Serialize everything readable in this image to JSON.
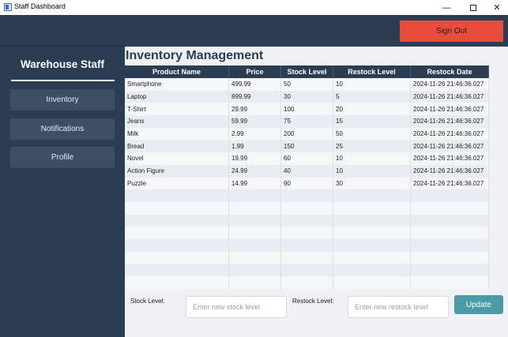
{
  "window": {
    "title": "Staff Dashboard",
    "min_glyph": "—",
    "close_glyph": "✕"
  },
  "header": {
    "signout_label": "Sign Out"
  },
  "sidebar": {
    "title": "Warehouse Staff",
    "items": [
      {
        "label": "Inventory"
      },
      {
        "label": "Notifications"
      },
      {
        "label": "Profile"
      }
    ]
  },
  "main": {
    "title": "Inventory Management"
  },
  "table": {
    "columns": [
      "Product Name",
      "Price",
      "Stock Level",
      "Restock Level",
      "Restock Date"
    ],
    "rows": [
      [
        "Smartphone",
        "499.99",
        "50",
        "10",
        "2024-11-26 21:46:36.027"
      ],
      [
        "Laptop",
        "899.99",
        "30",
        "5",
        "2024-11-26 21:46:36.027"
      ],
      [
        "T-Shirt",
        "29.99",
        "100",
        "20",
        "2024-11-26 21:46:36.027"
      ],
      [
        "Jeans",
        "59.99",
        "75",
        "15",
        "2024-11-26 21:46:36.027"
      ],
      [
        "Milk",
        "2.99",
        "200",
        "50",
        "2024-11-26 21:46:36.027"
      ],
      [
        "Bread",
        "1.99",
        "150",
        "25",
        "2024-11-26 21:46:36.027"
      ],
      [
        "Novel",
        "19.99",
        "60",
        "10",
        "2024-11-26 21:46:36.027"
      ],
      [
        "Action Figure",
        "24.99",
        "40",
        "10",
        "2024-11-26 21:46:36.027"
      ],
      [
        "Puzzle",
        "14.99",
        "90",
        "30",
        "2024-11-26 21:46:36.027"
      ],
      [
        "",
        "",
        "",
        "",
        ""
      ],
      [
        "",
        "",
        "",
        "",
        ""
      ],
      [
        "",
        "",
        "",
        "",
        ""
      ],
      [
        "",
        "",
        "",
        "",
        ""
      ],
      [
        "",
        "",
        "",
        "",
        ""
      ],
      [
        "",
        "",
        "",
        "",
        ""
      ],
      [
        "",
        "",
        "",
        "",
        ""
      ],
      [
        "",
        "",
        "",
        "",
        ""
      ]
    ]
  },
  "form": {
    "stock_label": "Stock Level:",
    "stock_placeholder": "Enter new stock level",
    "restock_label": "Restock Level:",
    "restock_placeholder": "Enter new restock level",
    "update_label": "Update"
  },
  "colors": {
    "navy": "#2b3d52",
    "signout": "#e74c3c",
    "update": "#4a9aa8"
  }
}
